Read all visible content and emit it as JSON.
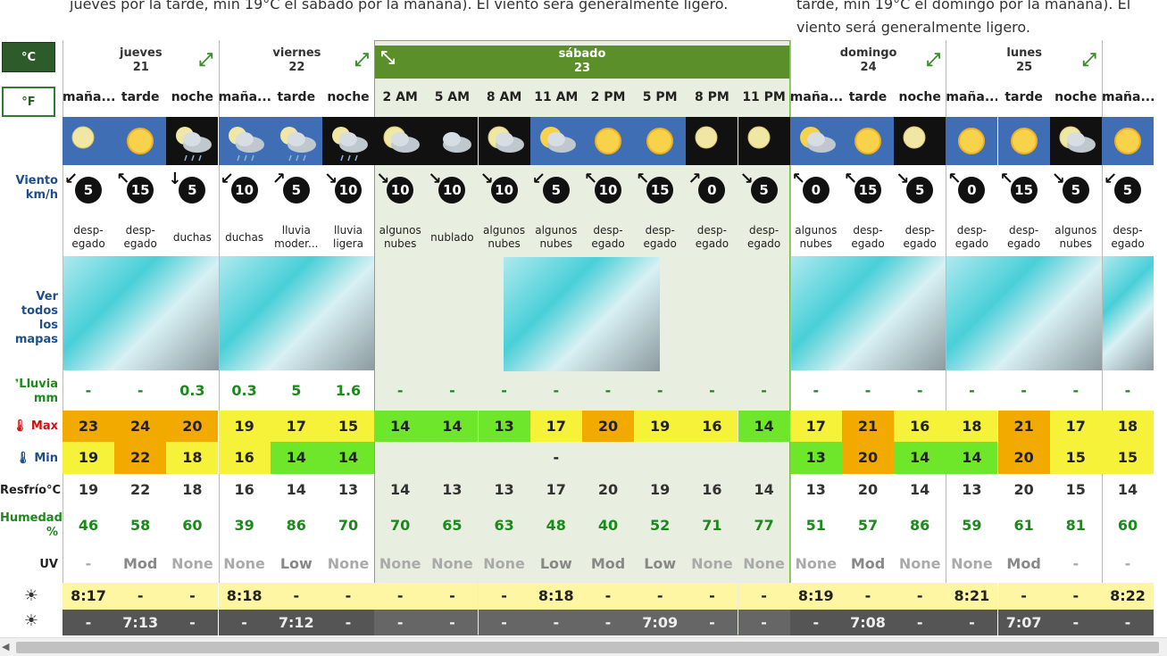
{
  "summary": {
    "text1": "jueves por la tarde, min 19°C el sábado por la mañana). El viento será generalmente ligero.",
    "text2": "tarde, min 19°C el domingo por la mañana). El viento será generalmente ligero."
  },
  "units": {
    "c": "°C",
    "f": "°F"
  },
  "labels": {
    "wind": "Viento\nkm/h",
    "maps": "Ver\ntodos los\nmapas",
    "rain": "Lluvia\nmm",
    "max": "Max",
    "min": "Min",
    "feel": "Resfrío°C",
    "humidity": "Humedad\n%",
    "uv": "UV"
  },
  "days": [
    {
      "name": "jueves",
      "num": "21",
      "selected": false
    },
    {
      "name": "viernes",
      "num": "22",
      "selected": false
    },
    {
      "name": "sábado",
      "num": "23",
      "selected": true
    },
    {
      "name": "domingo",
      "num": "24",
      "selected": false
    },
    {
      "name": "lunes",
      "num": "25",
      "selected": false
    },
    {
      "name": "",
      "num": "",
      "selected": false
    }
  ],
  "columns": [
    {
      "period": "maña...",
      "icon": "sun-moon",
      "night": false,
      "wind": "5",
      "wdir": "↙",
      "desc": "desp-\negado",
      "rain": "-",
      "max": "23",
      "maxc": "or",
      "min": "19",
      "minc": "ye",
      "feel": "19",
      "hum": "46",
      "uv": "-",
      "rise": "8:17",
      "set": "-"
    },
    {
      "period": "tarde",
      "icon": "sun",
      "night": false,
      "wind": "15",
      "wdir": "↖",
      "desc": "desp-\negado",
      "rain": "-",
      "max": "24",
      "maxc": "or",
      "min": "22",
      "minc": "or",
      "feel": "22",
      "hum": "58",
      "uv": "Mod",
      "rise": "-",
      "set": "7:13"
    },
    {
      "period": "noche",
      "icon": "cloud-rain",
      "night": true,
      "wind": "5",
      "wdir": "↓",
      "desc": "duchas",
      "rain": "0.3",
      "max": "20",
      "maxc": "or",
      "min": "18",
      "minc": "ye",
      "feel": "18",
      "hum": "60",
      "uv": "None",
      "rise": "-",
      "set": "-"
    },
    {
      "period": "maña...",
      "icon": "cloud-rain",
      "night": false,
      "wind": "10",
      "wdir": "↙",
      "desc": "duchas",
      "rain": "0.3",
      "max": "19",
      "maxc": "ye",
      "min": "16",
      "minc": "ye",
      "feel": "16",
      "hum": "39",
      "uv": "None",
      "rise": "8:18",
      "set": "-"
    },
    {
      "period": "tarde",
      "icon": "cloud-rain",
      "night": false,
      "wind": "5",
      "wdir": "↗",
      "desc": "lluvia\nmoder...",
      "rain": "5",
      "max": "17",
      "maxc": "ye",
      "min": "14",
      "minc": "gr",
      "feel": "14",
      "hum": "86",
      "uv": "Low",
      "rise": "-",
      "set": "7:12"
    },
    {
      "period": "noche",
      "icon": "cloud-rain",
      "night": true,
      "wind": "10",
      "wdir": "↘",
      "desc": "lluvia\nligera",
      "rain": "1.6",
      "max": "15",
      "maxc": "ye",
      "min": "14",
      "minc": "gr",
      "feel": "13",
      "hum": "70",
      "uv": "None",
      "rise": "-",
      "set": "-"
    },
    {
      "period": "2 AM",
      "icon": "moon-cloud",
      "night": true,
      "wind": "10",
      "wdir": "↘",
      "desc": "algunos\nnubes",
      "rain": "-",
      "max": "14",
      "maxc": "gr",
      "min": "",
      "minc": "",
      "feel": "14",
      "hum": "70",
      "uv": "None",
      "rise": "-",
      "set": "-"
    },
    {
      "period": "5 AM",
      "icon": "cloud",
      "night": true,
      "wind": "10",
      "wdir": "↘",
      "desc": "nublado",
      "rain": "-",
      "max": "14",
      "maxc": "gr",
      "min": "",
      "minc": "",
      "feel": "13",
      "hum": "65",
      "uv": "None",
      "rise": "-",
      "set": "-"
    },
    {
      "period": "8 AM",
      "icon": "moon-cloud",
      "night": true,
      "wind": "10",
      "wdir": "↘",
      "desc": "algunos\nnubes",
      "rain": "-",
      "max": "13",
      "maxc": "gr",
      "min": "",
      "minc": "",
      "feel": "13",
      "hum": "63",
      "uv": "None",
      "rise": "-",
      "set": "-"
    },
    {
      "period": "11 AM",
      "icon": "sun-cloud",
      "night": false,
      "wind": "5",
      "wdir": "↙",
      "desc": "algunos\nnubes",
      "rain": "-",
      "max": "17",
      "maxc": "ye",
      "min": "-",
      "minc": "",
      "feel": "17",
      "hum": "48",
      "uv": "Low",
      "rise": "8:18",
      "set": "-"
    },
    {
      "period": "2 PM",
      "icon": "sun",
      "night": false,
      "wind": "10",
      "wdir": "↖",
      "desc": "desp-\negado",
      "rain": "-",
      "max": "20",
      "maxc": "or",
      "min": "",
      "minc": "",
      "feel": "20",
      "hum": "40",
      "uv": "Mod",
      "rise": "-",
      "set": "-"
    },
    {
      "period": "5 PM",
      "icon": "sun",
      "night": false,
      "wind": "15",
      "wdir": "↖",
      "desc": "desp-\negado",
      "rain": "-",
      "max": "19",
      "maxc": "ye",
      "min": "",
      "minc": "",
      "feel": "19",
      "hum": "52",
      "uv": "Low",
      "rise": "-",
      "set": "7:09"
    },
    {
      "period": "8 PM",
      "icon": "moon",
      "night": true,
      "wind": "0",
      "wdir": "↗",
      "desc": "desp-\negado",
      "rain": "-",
      "max": "16",
      "maxc": "ye",
      "min": "",
      "minc": "",
      "feel": "16",
      "hum": "71",
      "uv": "None",
      "rise": "-",
      "set": "-"
    },
    {
      "period": "11 PM",
      "icon": "moon",
      "night": true,
      "wind": "5",
      "wdir": "↘",
      "desc": "desp-\negado",
      "rain": "-",
      "max": "14",
      "maxc": "gr",
      "min": "",
      "minc": "",
      "feel": "14",
      "hum": "77",
      "uv": "None",
      "rise": "-",
      "set": "-"
    },
    {
      "period": "maña...",
      "icon": "sun-cloud",
      "night": false,
      "wind": "0",
      "wdir": "↖",
      "desc": "algunos\nnubes",
      "rain": "-",
      "max": "17",
      "maxc": "ye",
      "min": "13",
      "minc": "gr",
      "feel": "13",
      "hum": "51",
      "uv": "None",
      "rise": "8:19",
      "set": "-"
    },
    {
      "period": "tarde",
      "icon": "sun",
      "night": false,
      "wind": "15",
      "wdir": "↖",
      "desc": "desp-\negado",
      "rain": "-",
      "max": "21",
      "maxc": "or",
      "min": "20",
      "minc": "or",
      "feel": "20",
      "hum": "57",
      "uv": "Mod",
      "rise": "-",
      "set": "7:08"
    },
    {
      "period": "noche",
      "icon": "moon",
      "night": true,
      "wind": "5",
      "wdir": "↘",
      "desc": "desp-\negado",
      "rain": "-",
      "max": "16",
      "maxc": "ye",
      "min": "14",
      "minc": "gr",
      "feel": "14",
      "hum": "86",
      "uv": "None",
      "rise": "-",
      "set": "-"
    },
    {
      "period": "maña...",
      "icon": "sun",
      "night": false,
      "wind": "0",
      "wdir": "↖",
      "desc": "desp-\negado",
      "rain": "-",
      "max": "18",
      "maxc": "ye",
      "min": "14",
      "minc": "gr",
      "feel": "13",
      "hum": "59",
      "uv": "None",
      "rise": "8:21",
      "set": "-"
    },
    {
      "period": "tarde",
      "icon": "sun",
      "night": false,
      "wind": "15",
      "wdir": "↖",
      "desc": "desp-\negado",
      "rain": "-",
      "max": "21",
      "maxc": "or",
      "min": "20",
      "minc": "or",
      "feel": "20",
      "hum": "61",
      "uv": "Mod",
      "rise": "-",
      "set": "7:07"
    },
    {
      "period": "noche",
      "icon": "moon-cloud",
      "night": true,
      "wind": "5",
      "wdir": "↘",
      "desc": "algunos\nnubes",
      "rain": "-",
      "max": "17",
      "maxc": "ye",
      "min": "15",
      "minc": "ye",
      "feel": "15",
      "hum": "81",
      "uv": "-",
      "rise": "-",
      "set": "-"
    },
    {
      "period": "maña...",
      "icon": "sun",
      "night": false,
      "wind": "5",
      "wdir": "↙",
      "desc": "desp-\negado",
      "rain": "-",
      "max": "18",
      "maxc": "ye",
      "min": "15",
      "minc": "ye",
      "feel": "14",
      "hum": "60",
      "uv": "-",
      "rise": "8:22",
      "set": "-"
    }
  ]
}
